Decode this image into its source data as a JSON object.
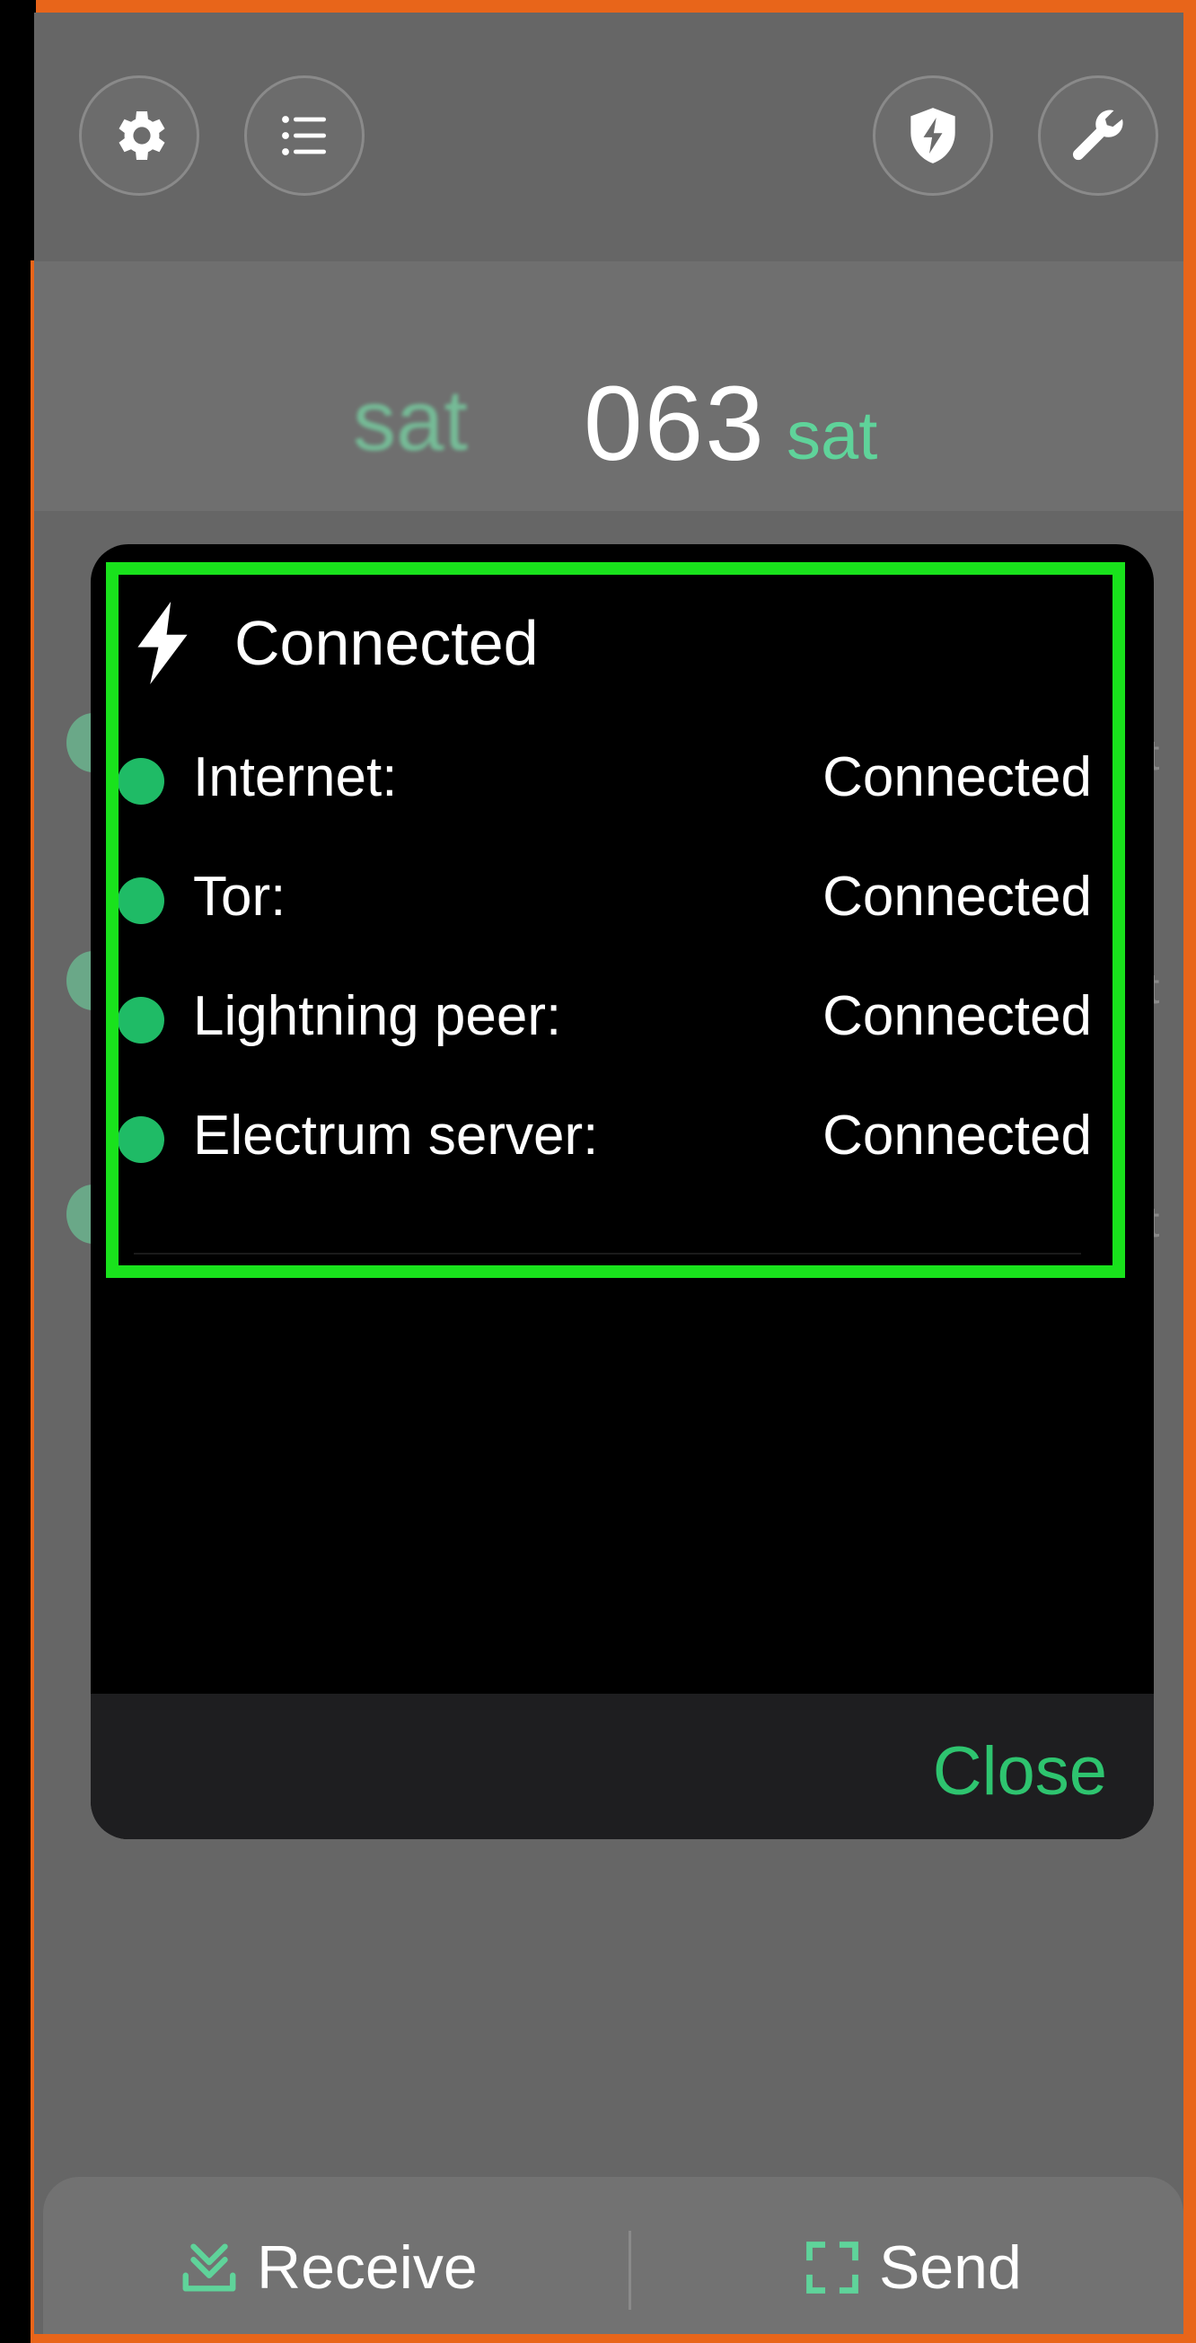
{
  "balance": {
    "amount_partial": "063",
    "unit": "sat",
    "unit_blurred": "sat"
  },
  "ghost_list": {
    "suffix": "t"
  },
  "modal": {
    "title": "Connected",
    "rows": [
      {
        "label": "Internet:",
        "value": "Connected"
      },
      {
        "label": "Tor:",
        "value": "Connected"
      },
      {
        "label": "Lightning peer:",
        "value": "Connected"
      },
      {
        "label": "Electrum server:",
        "value": "Connected"
      }
    ],
    "close_label": "Close"
  },
  "bottom_bar": {
    "receive_label": "Receive",
    "send_label": "Send"
  },
  "colors": {
    "accent": "#2ec46f",
    "status_ok": "#1fbb66",
    "highlight": "#19e21c"
  },
  "icons": {
    "top_left": [
      "gear-icon",
      "list-icon"
    ],
    "top_right": [
      "shield-bolt-icon",
      "wrench-icon"
    ],
    "modal_title": "bolt-icon",
    "receive": "receive-download-icon",
    "send": "scan-icon"
  }
}
